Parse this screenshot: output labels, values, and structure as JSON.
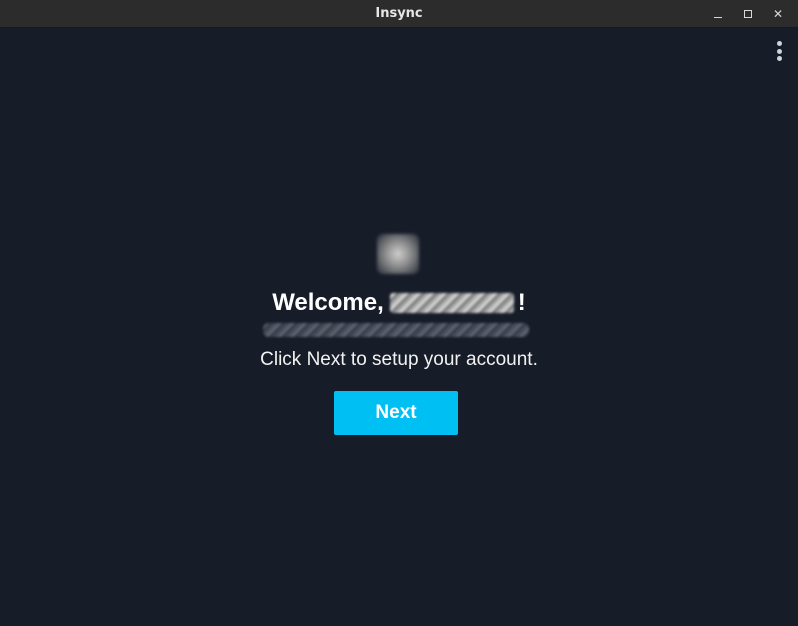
{
  "window": {
    "title": "Insync",
    "controls": {
      "minimize_icon": "minimize-icon",
      "maximize_icon": "maximize-icon",
      "close_icon": "close-icon",
      "close_glyph": "✕"
    }
  },
  "menu": {
    "icon": "kebab-menu-icon"
  },
  "welcome": {
    "greeting": "Welcome,",
    "name_redacted": true,
    "exclamation": "!",
    "email_redacted": true
  },
  "instruction": "Click Next to setup your account.",
  "next_button": {
    "label": "Next",
    "color": "#00c0f3"
  },
  "colors": {
    "background": "#161c28",
    "titlebar": "#2c2c2c",
    "accent": "#00c0f3"
  }
}
